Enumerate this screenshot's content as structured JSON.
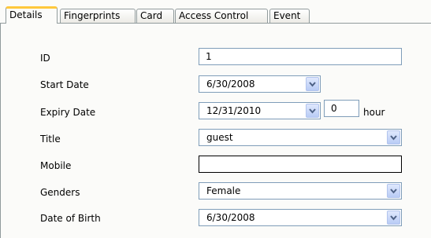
{
  "tabs": [
    {
      "label": "Details",
      "active": true
    },
    {
      "label": "Fingerprints",
      "active": false
    },
    {
      "label": "Card",
      "active": false
    },
    {
      "label": "Access Control",
      "active": false
    },
    {
      "label": "Event",
      "active": false
    }
  ],
  "form": {
    "id": {
      "label": "ID",
      "value": "1"
    },
    "start_date": {
      "label": "Start Date",
      "value": "6/30/2008"
    },
    "expiry_date": {
      "label": "Expiry Date",
      "value": "12/31/2010",
      "hour_value": "0",
      "hour_label": "hour"
    },
    "title": {
      "label": "Title",
      "value": "guest"
    },
    "mobile": {
      "label": "Mobile",
      "value": ""
    },
    "genders": {
      "label": "Genders",
      "value": "Female"
    },
    "date_of_birth": {
      "label": "Date of Birth",
      "value": "6/30/2008"
    }
  },
  "icons": {
    "dropdown": "chevron-down-icon"
  },
  "colors": {
    "active_tab_accent": "#ffc83c",
    "input_border": "#7f9db9",
    "dropdown_button": "#c9d8fb",
    "panel_background": "#fbfbf9"
  }
}
